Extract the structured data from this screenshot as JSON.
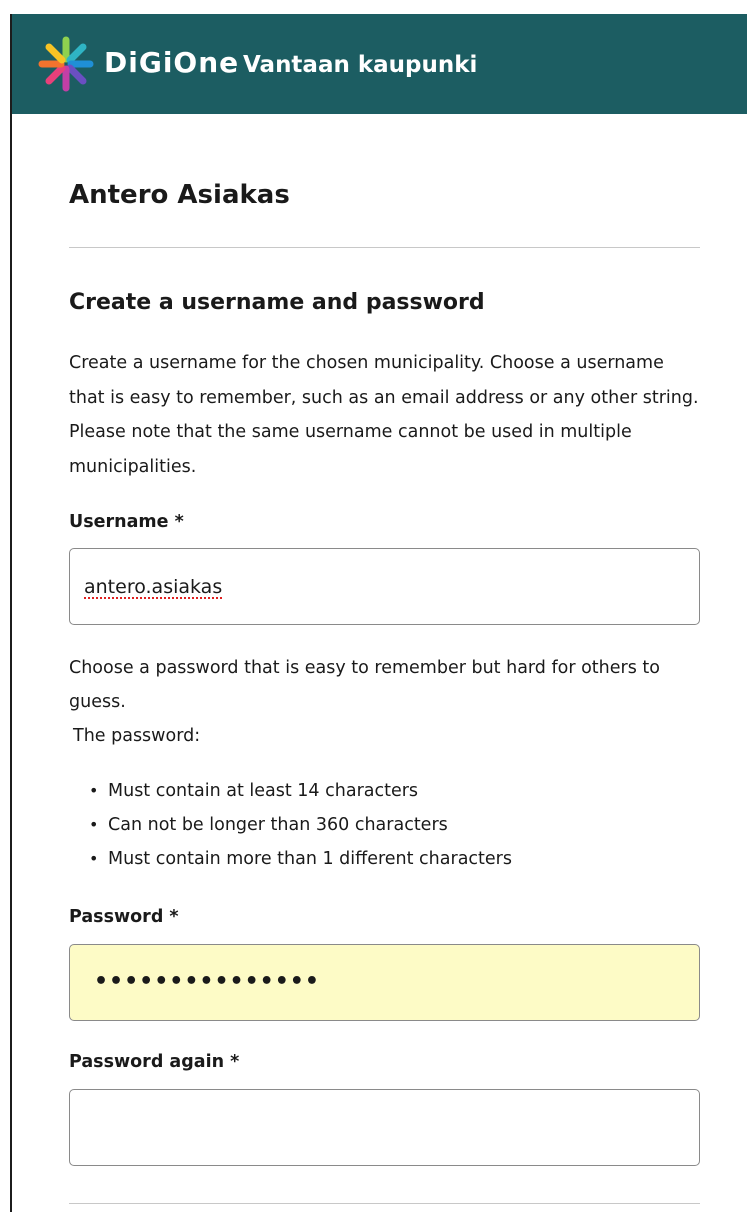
{
  "header": {
    "brand": "DiGiOne",
    "city": "Vantaan kaupunki",
    "colors": {
      "background": "#1c5d62",
      "text": "#ffffff"
    }
  },
  "user_name": "Antero Asiakas",
  "section_title": "Create a username and password",
  "intro_text": "Create a username for the chosen municipality. Choose a username that is easy to remember, such as an email address or any other string. Please note that the same username cannot be used in multiple municipalities.",
  "username": {
    "label": "Username *",
    "value": "antero.asiakas"
  },
  "password_help": "Choose a password that is easy to remember but hard for others to guess.",
  "password_rules_intro": "The password:",
  "password_rules": [
    "Must contain at least 14 characters",
    "Can not be longer than 360 characters",
    "Must contain more than 1 different characters"
  ],
  "password": {
    "label": "Password *",
    "masked_value": "•••••••••••••••",
    "autofill_color": "#fdfbc6"
  },
  "password_again": {
    "label": "Password again *",
    "value": ""
  }
}
